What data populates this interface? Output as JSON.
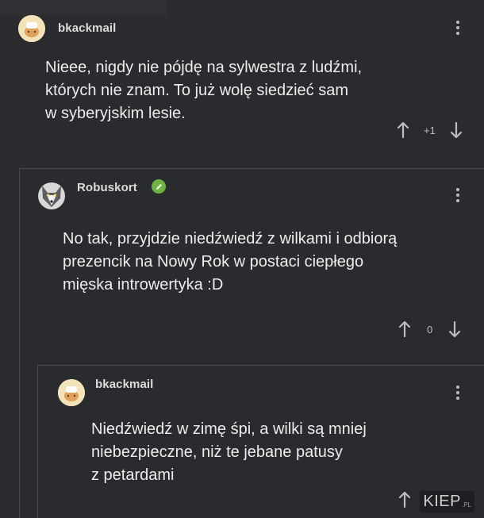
{
  "comments": [
    {
      "username": "bkackmail",
      "text": "Nieee, nigdy nie pójdę na sylwestra z ludźmi,\nktórych nie znam. To już wolę siedzieć sam\nw syberyjskim lesie.",
      "vote_count": "+1",
      "avatar": "egg-chef-avatar"
    },
    {
      "username": "Robuskort",
      "badge_icon": "pencil-icon",
      "text": "No tak, przyjdzie niedźwiedź z wilkami i odbiorą\nprezencik na Nowy Rok w postaci ciepłego\nmięska introwertyka :D",
      "vote_count": "0",
      "avatar": "wolf-avatar"
    },
    {
      "username": "bkackmail",
      "text": "Niedźwiedź w zimę śpi, a wilki są mniej\nniebezpieczne, niż te jebane patusy\nz petardami",
      "avatar": "egg-chef-avatar"
    }
  ],
  "watermark": {
    "main": "KIEP",
    "suffix": ".PL"
  },
  "colors": {
    "background": "#2a2b2f",
    "text": "#ededed",
    "badge": "#6db33f"
  }
}
